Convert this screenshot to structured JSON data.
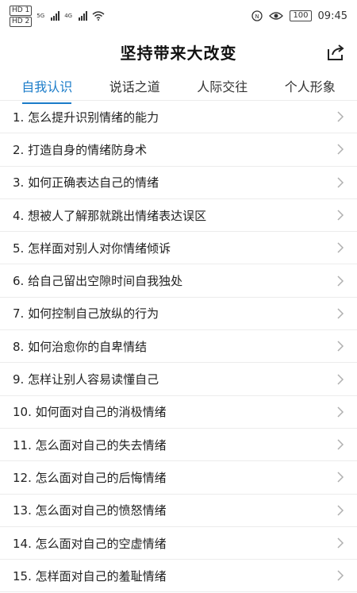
{
  "status": {
    "sim1": "HD 1",
    "sim2": "HD 2",
    "net1": "5G",
    "net2": "4G",
    "battery": "100",
    "time": "09:45",
    "icons": [
      "signal-icon",
      "wifi-icon",
      "nfc-icon",
      "eye-icon",
      "battery-icon"
    ]
  },
  "header": {
    "title": "坚持带来大改变",
    "share_icon": "share-icon"
  },
  "tabs": [
    {
      "label": "自我认识",
      "active": true
    },
    {
      "label": "说话之道",
      "active": false
    },
    {
      "label": "人际交往",
      "active": false
    },
    {
      "label": "个人形象",
      "active": false
    }
  ],
  "accent": "#1b7cc9",
  "items": [
    "1. 怎么提升识别情绪的能力",
    "2. 打造自身的情绪防身术",
    "3. 如何正确表达自己的情绪",
    "4. 想被人了解那就跳出情绪表达误区",
    "5. 怎样面对别人对你情绪倾诉",
    "6. 给自己留出空隙时间自我独处",
    "7. 如何控制自己放纵的行为",
    "8. 如何治愈你的自卑情结",
    "9. 怎样让别人容易读懂自己",
    "10. 如何面对自己的消极情绪",
    "11. 怎么面对自己的失去情绪",
    "12. 怎么面对自己的后悔情绪",
    "13. 怎么面对自己的愤怒情绪",
    "14. 怎么面对自己的空虚情绪",
    "15. 怎样面对自己的羞耻情绪"
  ]
}
